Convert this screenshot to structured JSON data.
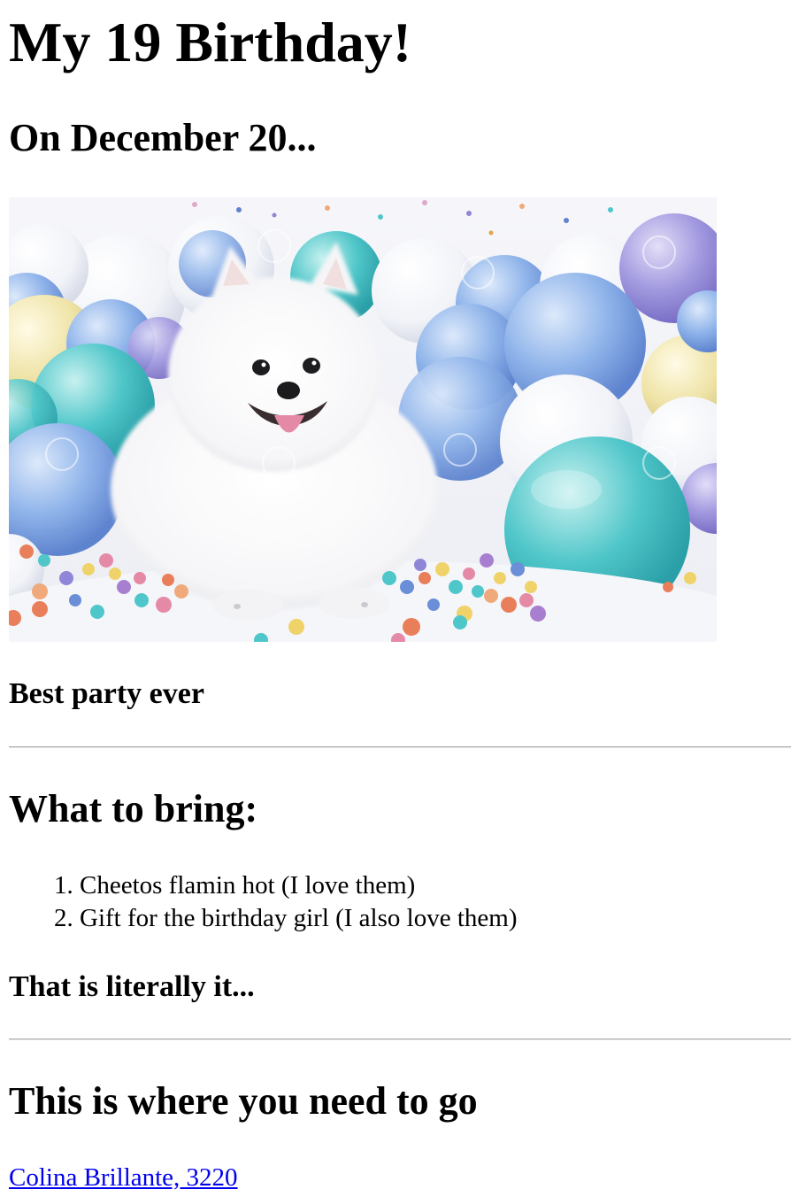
{
  "header": {
    "title": "My 19 Birthday!",
    "subtitle": "On December 20..."
  },
  "hero_image": {
    "colors": {
      "background": "#f4f5fa",
      "dog_fur": "#ffffff",
      "balloon_blue": "#8fb4ea",
      "balloon_teal": "#4fc6c9",
      "balloon_purple": "#8f86d8",
      "balloon_yellow": "#efe3a6",
      "balloon_white": "#fbfbfd"
    }
  },
  "caption": "Best party ever",
  "bring_section": {
    "heading": "What to bring:",
    "items": [
      "Cheetos flamin hot (I love them)",
      "Gift for the birthday girl (I also love them)"
    ],
    "note": "That is literally it..."
  },
  "location_section": {
    "heading": "This is where you need to go",
    "address_link": "Colina Brillante, 3220"
  }
}
